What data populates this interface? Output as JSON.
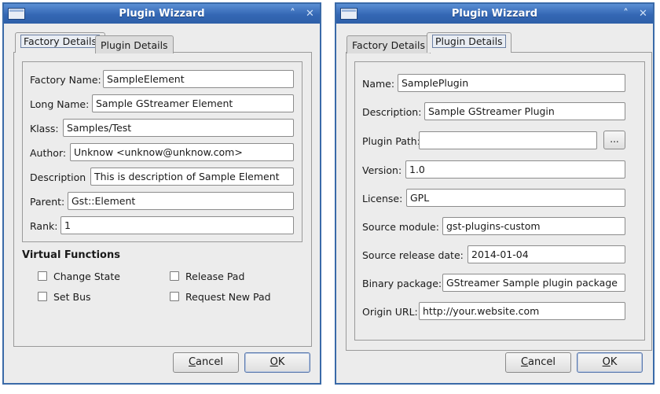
{
  "left_dialog": {
    "title": "Plugin Wizzard",
    "tabs": [
      "Factory Details",
      "Plugin Details"
    ],
    "active_tab": "Factory Details",
    "fields": [
      {
        "label": "Factory Name:",
        "value": "SampleElement"
      },
      {
        "label": "Long Name:",
        "value": "Sample GStreamer Element"
      },
      {
        "label": "Klass:",
        "value": "Samples/Test"
      },
      {
        "label": "Author:",
        "value": "Unknow <unknow@unknow.com>"
      },
      {
        "label": "Description",
        "value": "This is description of Sample Element"
      },
      {
        "label": "Parent:",
        "value": "Gst::Element"
      },
      {
        "label": "Rank:",
        "value": "1"
      }
    ],
    "virtual_functions": {
      "title": "Virtual Functions",
      "options": [
        {
          "label": "Change State",
          "checked": false
        },
        {
          "label": "Release Pad",
          "checked": false
        },
        {
          "label": "Set Bus",
          "checked": false
        },
        {
          "label": "Request New Pad",
          "checked": false
        }
      ]
    },
    "buttons": {
      "cancel_mnemonic": "C",
      "cancel_rest": "ancel",
      "ok_mnemonic": "O",
      "ok_rest": "K"
    }
  },
  "right_dialog": {
    "title": "Plugin Wizzard",
    "tabs": [
      "Factory Details",
      "Plugin Details"
    ],
    "active_tab": "Plugin Details",
    "fields": [
      {
        "label": "Name:",
        "value": "SamplePlugin"
      },
      {
        "label": "Description:",
        "value": "Sample GStreamer Plugin"
      },
      {
        "label": "Plugin Path:",
        "value": ""
      },
      {
        "label": "Version:",
        "value": "1.0"
      },
      {
        "label": "License:",
        "value": "GPL"
      },
      {
        "label": "Source module:",
        "value": "gst-plugins-custom"
      },
      {
        "label": "Source release date:",
        "value": "2014-01-04"
      },
      {
        "label": "Binary package:",
        "value": "GStreamer Sample plugin package"
      },
      {
        "label": "Origin URL:",
        "value": "http://your.website.com"
      }
    ],
    "browse_label": "...",
    "buttons": {
      "cancel_mnemonic": "C",
      "cancel_rest": "ancel",
      "ok_mnemonic": "O",
      "ok_rest": "K"
    }
  },
  "titlebar_icons": [
    "window-menu-icon",
    "maximize-icon",
    "close-icon"
  ],
  "colors": {
    "titlebar": "#3467b4",
    "window_bg": "#ececec",
    "border": "#3a6aa8"
  }
}
